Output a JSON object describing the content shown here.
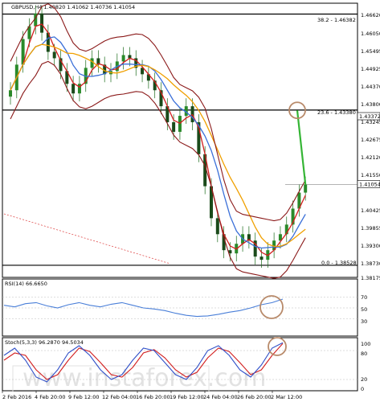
{
  "chart_data": [
    {
      "type": "line",
      "title": "GBPUSD,H4  1.40820 1.41062 1.40736 1.41054",
      "symbol": "GBPUSD,H4",
      "ohlc": [
        1.4082,
        1.41062,
        1.40736,
        1.41054
      ],
      "price_ticks": [
        "1.46620",
        "1.46050",
        "1.45495",
        "1.44925",
        "1.44370",
        "1.43800",
        "1.43245",
        "1.42675",
        "1.42120",
        "1.41550",
        "1.40425",
        "1.39855",
        "1.39300",
        "1.38730",
        "1.38175"
      ],
      "current_price_label": "1.41054",
      "current_price": 1.41054,
      "fib_levels": [
        {
          "label": "38.2 - 1.46382",
          "value": 1.46382
        },
        {
          "label": "23.6 - 1.43380",
          "value": 1.4338
        },
        {
          "label": "0.0 - 1.38528",
          "value": 1.38528
        }
      ],
      "marker_price_label": "1.43372",
      "marker_price": 1.43372,
      "ylim": [
        1.38175,
        1.4662
      ],
      "x_ticks": [
        "2 Feb 2016",
        "4 Feb 20:00",
        "9 Feb 12:00",
        "12 Feb 04:00",
        "16 Feb 20:00",
        "19 Feb 12:00",
        "24 Feb 04:00",
        "26 Feb 20:00",
        "2 Mar 12:00"
      ],
      "close": [
        1.44,
        1.448,
        1.456,
        1.46,
        1.464,
        1.458,
        1.452,
        1.45,
        1.446,
        1.442,
        1.439,
        1.442,
        1.447,
        1.45,
        1.448,
        1.445,
        1.446,
        1.449,
        1.451,
        1.45,
        1.447,
        1.445,
        1.443,
        1.44,
        1.435,
        1.43,
        1.427,
        1.432,
        1.435,
        1.43,
        1.42,
        1.41,
        1.4,
        1.395,
        1.39,
        1.389,
        1.392,
        1.395,
        1.393,
        1.388,
        1.387,
        1.39,
        1.393,
        1.395,
        1.398,
        1.403,
        1.408,
        1.4105
      ]
    },
    {
      "type": "line",
      "title": "RSI(14) 66.6650",
      "value": 66.665,
      "y_ticks": [
        "70",
        "50",
        "30"
      ],
      "ylim": [
        0,
        100
      ],
      "values": [
        55,
        52,
        58,
        60,
        54,
        50,
        56,
        60,
        55,
        52,
        57,
        60,
        55,
        50,
        48,
        45,
        40,
        36,
        34,
        35,
        38,
        42,
        45,
        50,
        56,
        60,
        66.665
      ]
    },
    {
      "type": "line",
      "title": "Stoch(5,3,3) 96.2870 94.5034",
      "main_value": 96.287,
      "signal_value": 94.5034,
      "y_ticks": [
        "100",
        "80",
        "20",
        "0"
      ],
      "ylim": [
        0,
        100
      ],
      "series": [
        {
          "values": [
            70,
            85,
            60,
            25,
            15,
            40,
            75,
            90,
            70,
            40,
            20,
            30,
            60,
            85,
            80,
            55,
            30,
            20,
            45,
            80,
            90,
            70,
            40,
            25,
            50,
            85,
            96.287
          ]
        },
        {
          "values": [
            60,
            75,
            70,
            40,
            20,
            30,
            60,
            85,
            78,
            55,
            30,
            25,
            45,
            75,
            82,
            65,
            40,
            25,
            35,
            65,
            85,
            78,
            55,
            30,
            40,
            70,
            94.5034
          ]
        }
      ]
    }
  ],
  "watermark": "www.instaforex.com",
  "colors": {
    "bollinger": "#8b1a1a",
    "ma_blue": "#3a6fd8",
    "ma_red": "#d21e1e",
    "ma_orange": "#f0a000",
    "projection": "#35b535",
    "trend_dashed": "#e05050",
    "marker_circle": "#b88a6a",
    "rsi_line": "#4a7fd8",
    "stoch_main": "#2f4fc8",
    "stoch_signal": "#d21e1e",
    "price_tag_bg": "#ffffff"
  }
}
